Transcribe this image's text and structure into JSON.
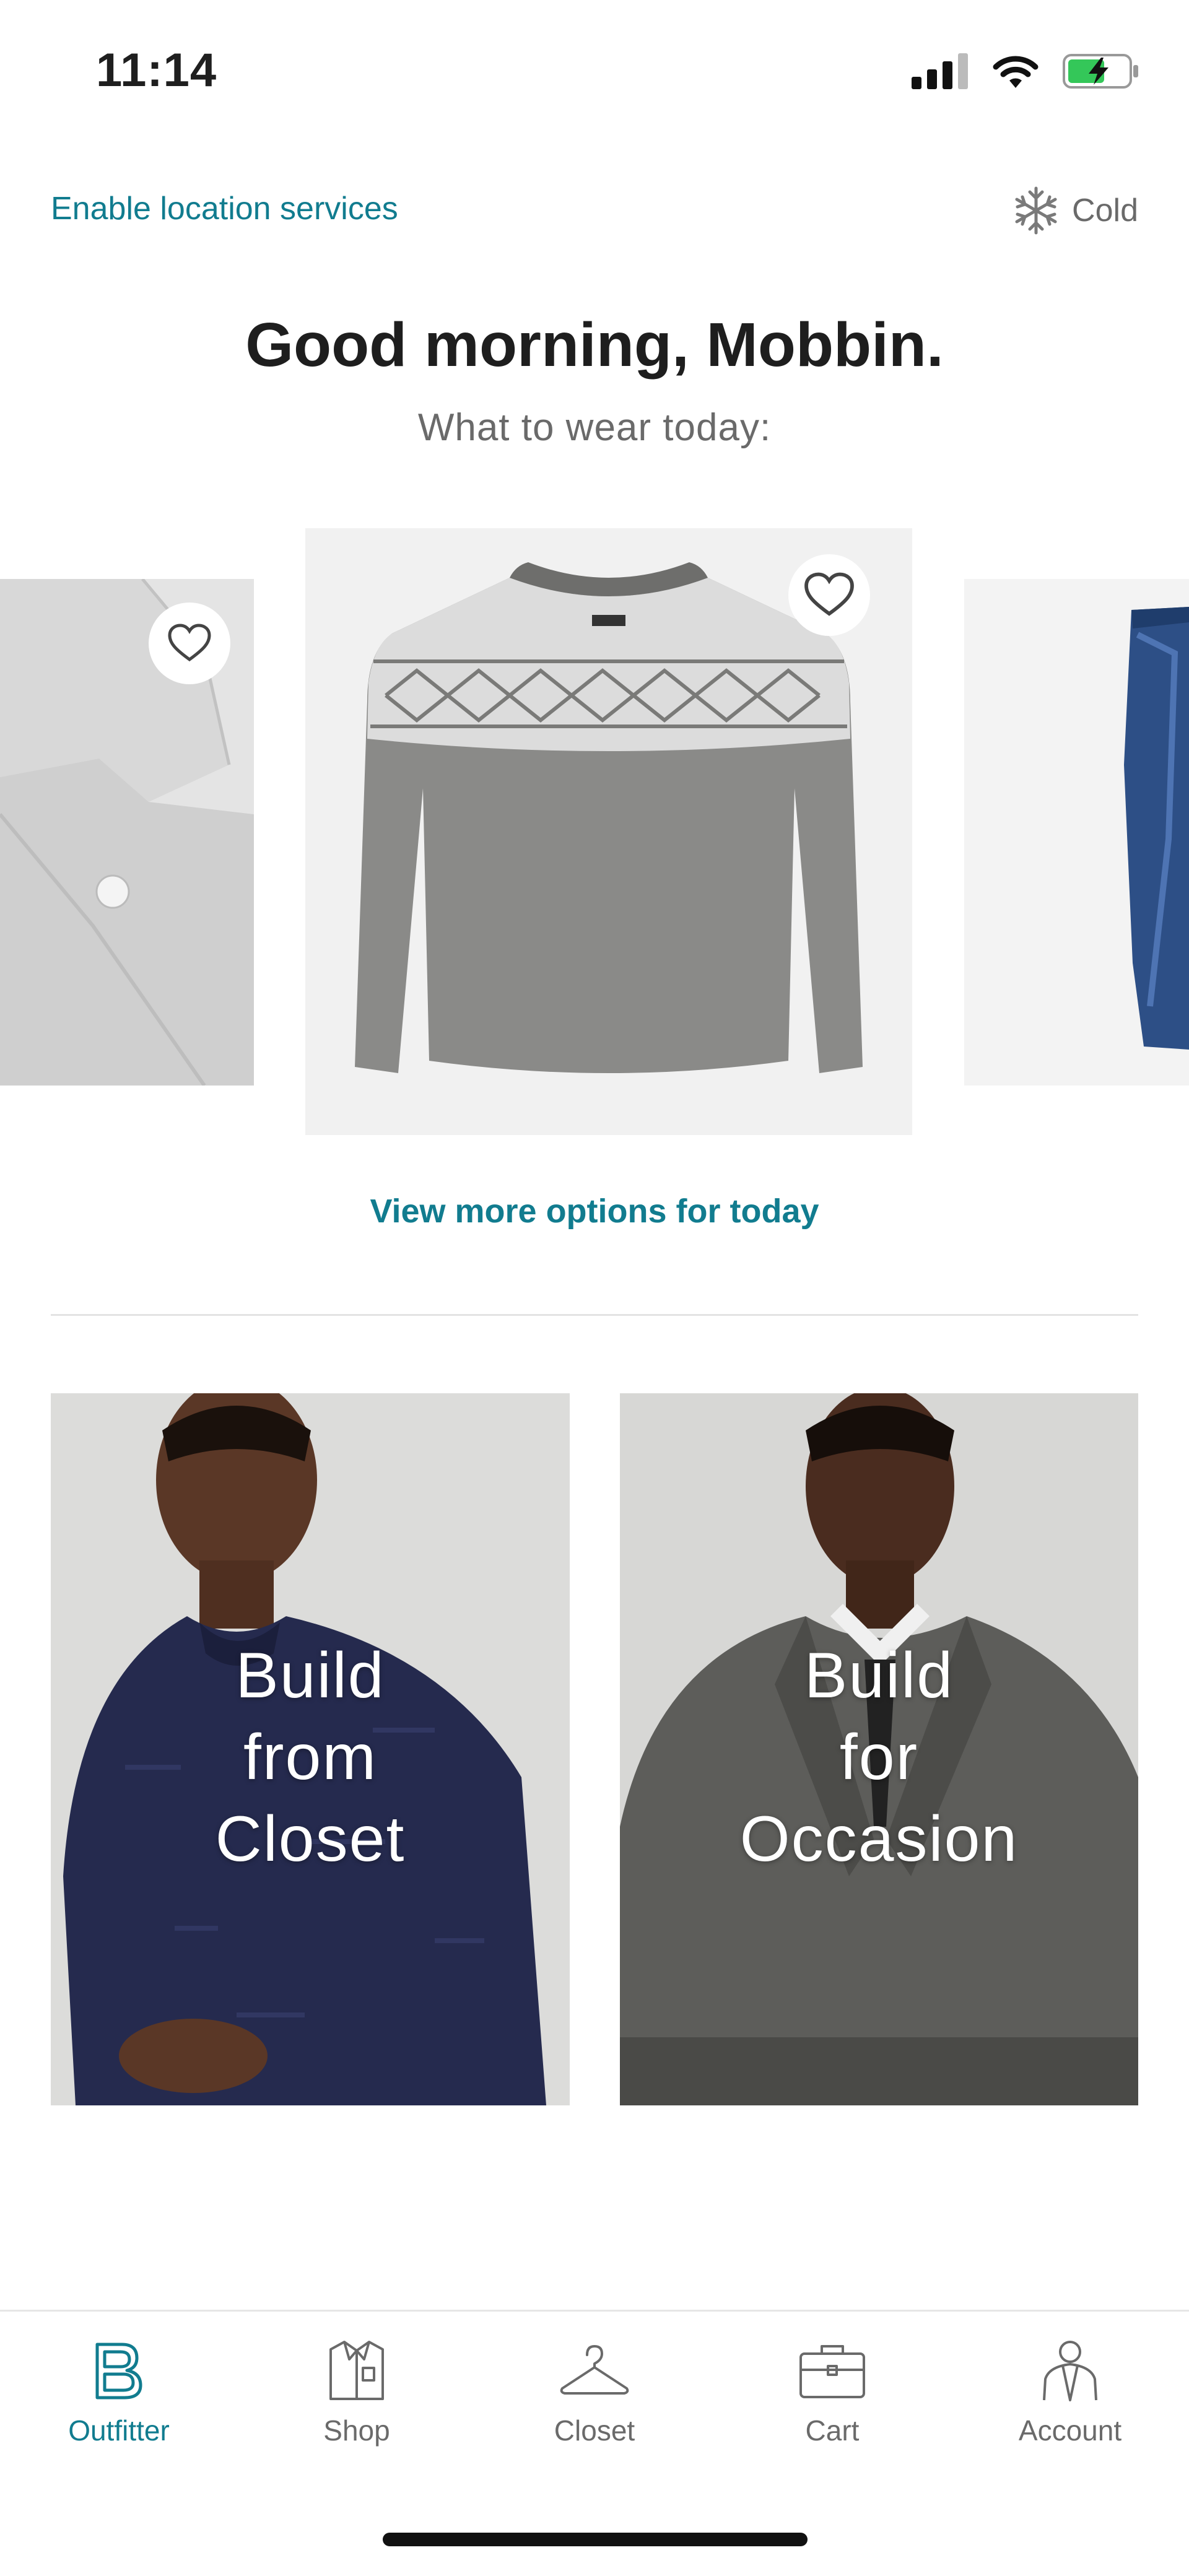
{
  "status_bar": {
    "time": "11:14"
  },
  "header": {
    "location_link": "Enable location services",
    "weather_label": "Cold",
    "weather_icon": "snowflake-icon"
  },
  "greeting": {
    "title": "Good morning, Mobbin.",
    "subtitle": "What to wear today:"
  },
  "carousel": {
    "items": [
      {
        "name": "Shirt",
        "favorite": false,
        "icon": "heart-outline-icon"
      },
      {
        "name": "Fair Isle Sweater",
        "favorite": false,
        "icon": "heart-outline-icon"
      },
      {
        "name": "Jeans",
        "favorite": false,
        "icon": "heart-outline-icon"
      }
    ],
    "view_more_label": "View more options for today"
  },
  "build_tiles": [
    {
      "label_lines": [
        "Build",
        "from",
        "Closet"
      ],
      "sweater_color": "#22274a"
    },
    {
      "label_lines": [
        "Build",
        "for",
        "Occasion"
      ],
      "suit_color": "#5b5b58"
    }
  ],
  "tab_bar": {
    "tabs": [
      {
        "label": "Outfitter",
        "icon": "bonobos-b-icon",
        "active": true
      },
      {
        "label": "Shop",
        "icon": "shirt-icon",
        "active": false
      },
      {
        "label": "Closet",
        "icon": "hanger-icon",
        "active": false
      },
      {
        "label": "Cart",
        "icon": "briefcase-icon",
        "active": false
      },
      {
        "label": "Account",
        "icon": "person-icon",
        "active": false
      }
    ]
  },
  "colors": {
    "accent": "#117c8f",
    "text_muted": "#6a6a6a",
    "text_dark": "#1e1e1e"
  }
}
